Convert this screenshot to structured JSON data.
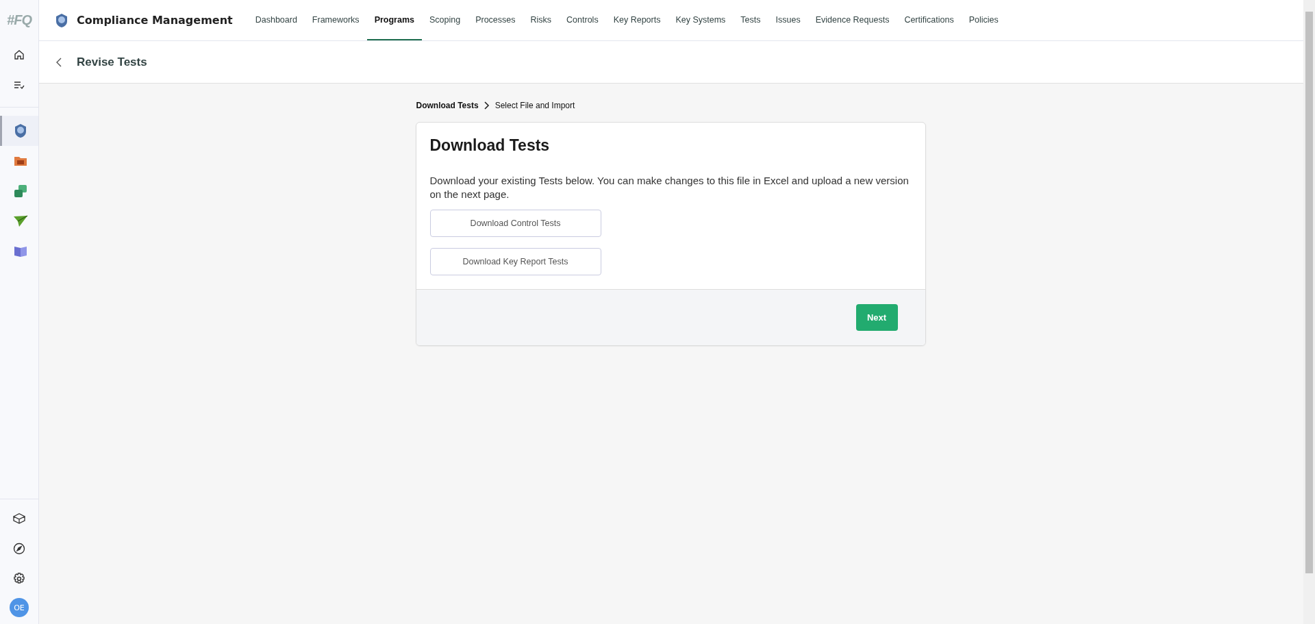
{
  "app": {
    "logo": "#FQ",
    "module_title": "Compliance Management"
  },
  "nav": [
    {
      "label": "Dashboard",
      "selected": false
    },
    {
      "label": "Frameworks",
      "selected": false
    },
    {
      "label": "Programs",
      "selected": true
    },
    {
      "label": "Scoping",
      "selected": false
    },
    {
      "label": "Processes",
      "selected": false
    },
    {
      "label": "Risks",
      "selected": false
    },
    {
      "label": "Controls",
      "selected": false
    },
    {
      "label": "Key Reports",
      "selected": false
    },
    {
      "label": "Key Systems",
      "selected": false
    },
    {
      "label": "Tests",
      "selected": false
    },
    {
      "label": "Issues",
      "selected": false
    },
    {
      "label": "Evidence Requests",
      "selected": false
    },
    {
      "label": "Certifications",
      "selected": false
    },
    {
      "label": "Policies",
      "selected": false
    }
  ],
  "sidebar": {
    "top": [
      {
        "kind": "home"
      },
      {
        "kind": "tasks"
      }
    ],
    "modules": [
      {
        "kind": "shield",
        "selected": true
      },
      {
        "kind": "folder",
        "selected": false
      },
      {
        "kind": "sync",
        "selected": false
      },
      {
        "kind": "plane",
        "selected": false
      },
      {
        "kind": "book",
        "selected": false
      }
    ],
    "bottom": [
      {
        "kind": "box"
      },
      {
        "kind": "compass"
      },
      {
        "kind": "gear"
      }
    ],
    "avatar": "OE"
  },
  "page": {
    "title": "Revise Tests"
  },
  "steps": [
    {
      "label": "Download Tests",
      "selected": true
    },
    {
      "label": "Select File and Import",
      "selected": false
    }
  ],
  "card": {
    "title": "Download Tests",
    "description": "Download your existing Tests below. You can make changes to this file in Excel and upload a new version on the next page.",
    "buttons": [
      "Download Control Tests",
      "Download Key Report Tests"
    ],
    "next": "Next"
  }
}
